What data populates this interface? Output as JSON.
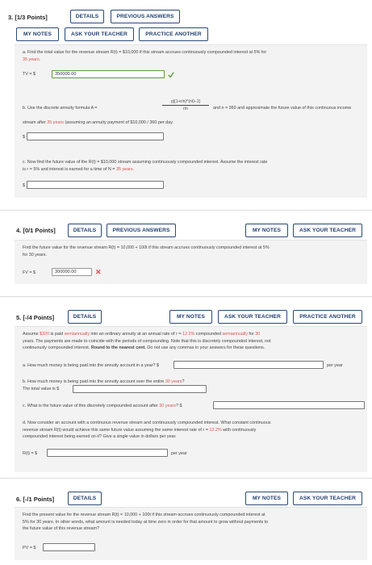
{
  "q3": {
    "number": "3.",
    "points": "[1/3 Points]",
    "details": "DETAILS",
    "previous_answers": "PREVIOUS ANSWERS",
    "my_notes": "MY NOTES",
    "ask_teacher": "ASK YOUR TEACHER",
    "practice_another": "PRACTICE ANOTHER",
    "part_a_pre": "a. Find the total value for the revenue stream R(t) = $10,000 if this stream accrues continuously compounded interest at 5% for",
    "part_a_years": "35 years.",
    "tv_label": "TV = $",
    "tv_value": "350000.00",
    "part_b_pre": "b. Use the discrete annuity formula A =",
    "formula_num": "p[(1+r/n)^(nt)−1]",
    "formula_den": "r/n",
    "part_b_post": "and n = 360 and approximate the future value of this continuous income",
    "part_b_line2_pre": "stream after",
    "part_b_line2_years": "35 years",
    "part_b_line2_post": "(assuming an annuity payment of $10,000 / 360 per day.",
    "dollar": "$",
    "part_c_line1": "c. Now find the future value of the R(t) = $10,000 stream assuming continuously compounded interest. Assume the interest rate",
    "part_c_line2_pre": "is r = 5% and interest is earned for a time of N =",
    "part_c_line2_years": "35 years."
  },
  "q4": {
    "number": "4.",
    "points": "[0/1 Points]",
    "details": "DETAILS",
    "previous_answers": "PREVIOUS ANSWERS",
    "my_notes": "MY NOTES",
    "ask_teacher": "ASK YOUR TEACHER",
    "line1": "Find the future value for the revenue stream R(t) = 10,000 + 100t if this stream accrues continuously compounded interest at 5%",
    "line2": "for 30 years.",
    "fv_label": "FV = $",
    "fv_value": "300000.00"
  },
  "q5": {
    "number": "5.",
    "points": "[-/4 Points]",
    "details": "DETAILS",
    "my_notes": "MY NOTES",
    "ask_teacher": "ASK YOUR TEACHER",
    "practice_another": "PRACTICE ANOTHER",
    "intro_l1_a": "Assume",
    "intro_l1_amt": "$320",
    "intro_l1_b": "is paid",
    "intro_l1_semi": "semiannually",
    "intro_l1_c": "into an ordinary annuity at an annual rate of r =",
    "intro_l1_rate": "12.2%",
    "intro_l1_d": "compounded",
    "intro_l1_semi2": "semiannually",
    "intro_l1_e": "for",
    "intro_l1_years": "30",
    "intro_l2": "years. The payments are made to coincide with the periods of compounding. Note that this is discretely compounded interest, not",
    "intro_l3_a": "continuously compounded interest.",
    "intro_l3_bold": "Round to the nearest cent.",
    "intro_l3_c": "Do not use any commas in your answers for these questions.",
    "part_a": "a. How much money is being paid into the annuity account in a year? $",
    "per_year": "per year",
    "part_b_pre": "b. How much money is being paid into the annuity account over the entire",
    "part_b_years": "30 years",
    "part_b_post": "?",
    "part_b_total": "The total value is $",
    "part_c_pre": "c. What is the future value of this discretely compounded account after",
    "part_c_years": "30 years",
    "part_c_post": "? $",
    "part_d_l1": "d. Now consider an account with a continuous revenue stream and continuously compounded interest. What constant continuous",
    "part_d_l2_pre": "revenue stream R(t) would achieve this same future value assuming the same interest rate of r =",
    "part_d_l2_rate": "12.2%",
    "part_d_l2_post": "with continuously",
    "part_d_l3": "compounded interest being earned on it? Give a single value in dollars per year.",
    "rt_label": "R(t) = $",
    "per_year2": "per year"
  },
  "q6": {
    "number": "6.",
    "points": "[-/1 Points]",
    "details": "DETAILS",
    "my_notes": "MY NOTES",
    "ask_teacher": "ASK YOUR TEACHER",
    "line1": "Find the present value for the revenue stream R(t) = 10,000 + 100t if this stream accrues continuously compounded interest at",
    "line2": "5% for 30 years. In other words, what amount is needed today at time zero in order for that amount to grow without payments to",
    "line3": "the future value of this revenue stream?",
    "pv_label": "PV = $"
  },
  "colors": {
    "button_border": "#2b4a7a",
    "highlight_red": "#d9534f",
    "correct_green": "#5a9e3a",
    "panel_bg": "#f3f3f3"
  }
}
